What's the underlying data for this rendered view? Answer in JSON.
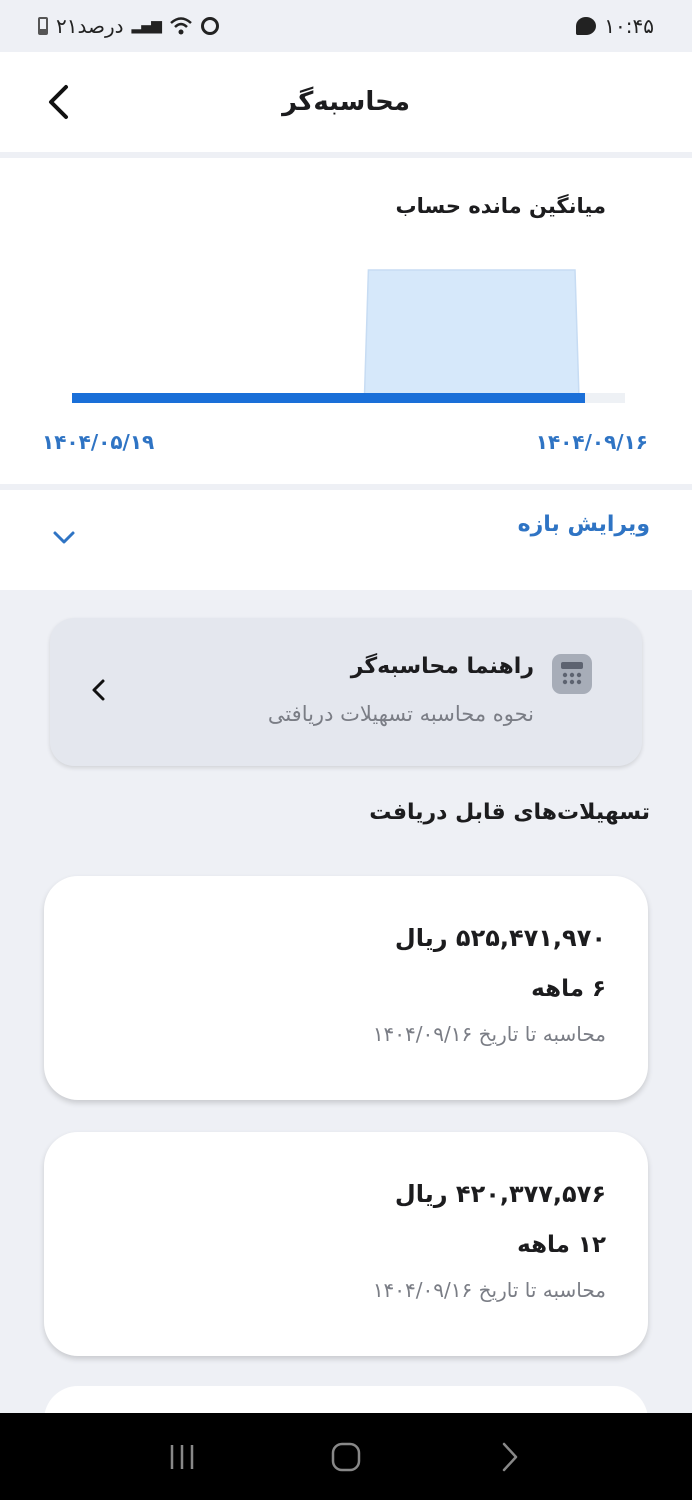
{
  "status_bar": {
    "time": "۱۰:۴۵",
    "battery_text": "۲۱درصد"
  },
  "header": {
    "title": "محاسبه‌گر"
  },
  "chart": {
    "title": "میانگین مانده حساب",
    "start_date": "۱۴۰۴/۰۵/۱۹",
    "end_date": "۱۴۰۴/۰۹/۱۶",
    "accent_color": "#1a6fd8",
    "fill_color": "#d6e8fa"
  },
  "chart_data": {
    "type": "area",
    "title": "میانگین مانده حساب",
    "x": [
      "۱۴۰۴/۰۵/۱۹",
      "۱۴۰۴/۰۹/۱۶"
    ],
    "segments": [
      {
        "from": 0.0,
        "to": 0.57,
        "value": 0
      },
      {
        "from": 0.57,
        "to": 1.0,
        "value": 1
      }
    ],
    "xlabel": "",
    "ylabel": "",
    "grid": false
  },
  "edit_range": {
    "label": "ویرایش بازه"
  },
  "guide": {
    "title": "راهنما محاسبه‌گر",
    "subtitle": "نحوه محاسبه تسهیلات دریافتی"
  },
  "section": {
    "title": "تسهیلات‌های قابل دریافت"
  },
  "loans": [
    {
      "amount": "۵۲۵,۴۷۱,۹۷۰ ریال",
      "term": "۶ ماهه",
      "date_note": "محاسبه تا تاریخ ۱۴۰۴/۰۹/۱۶"
    },
    {
      "amount": "۴۲۰,۳۷۷,۵۷۶ ریال",
      "term": "۱۲ ماهه",
      "date_note": "محاسبه تا تاریخ ۱۴۰۴/۰۹/۱۶"
    }
  ]
}
